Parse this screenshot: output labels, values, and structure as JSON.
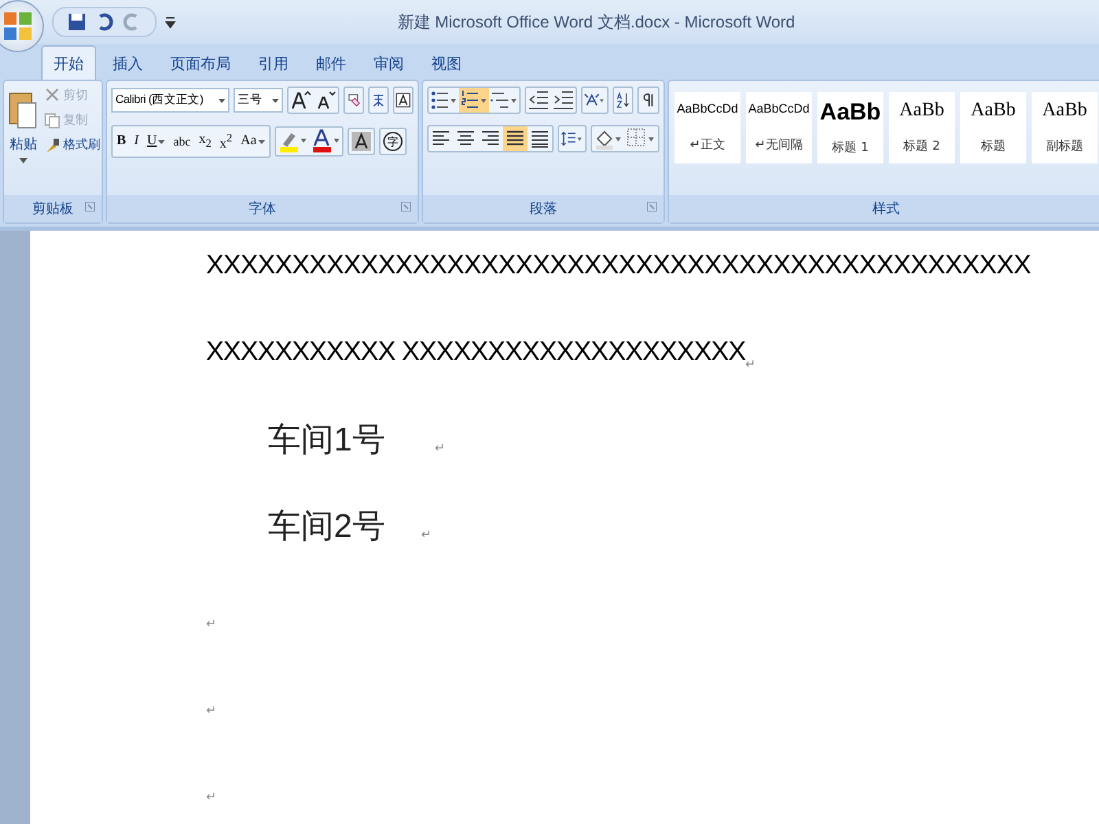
{
  "window": {
    "title": "新建 Microsoft Office Word 文档.docx - Microsoft Word"
  },
  "tabs": [
    {
      "label": "开始",
      "selected": true
    },
    {
      "label": "插入",
      "selected": false
    },
    {
      "label": "页面布局",
      "selected": false
    },
    {
      "label": "引用",
      "selected": false
    },
    {
      "label": "邮件",
      "selected": false
    },
    {
      "label": "审阅",
      "selected": false
    },
    {
      "label": "视图",
      "selected": false
    }
  ],
  "clipboard": {
    "label": "剪贴板",
    "paste": "粘贴",
    "items": [
      {
        "kind": "cut",
        "label": "剪切",
        "disabled": true
      },
      {
        "kind": "copy",
        "label": "复制",
        "disabled": true
      },
      {
        "kind": "painter",
        "label": "格式刷",
        "disabled": false
      }
    ]
  },
  "font": {
    "label": "字体",
    "font_name": "Calibri (西文正文)",
    "font_size": "三号",
    "format_buttons": [
      {
        "kind": "bold",
        "label": "B",
        "dropdown": false
      },
      {
        "kind": "italic",
        "label": "I",
        "dropdown": false
      },
      {
        "kind": "underline",
        "label": "U",
        "dropdown": true
      },
      {
        "kind": "strike",
        "label": "abc",
        "dropdown": false
      },
      {
        "kind": "plain",
        "label": "x$_{2}$",
        "dropdown": false
      },
      {
        "kind": "plain",
        "label": "x$^{2}$",
        "dropdown": false
      },
      {
        "kind": "plain",
        "label": "Aa",
        "dropdown": true
      }
    ],
    "enclosed_char": "字"
  },
  "paragraph": {
    "label": "段落",
    "lists": [
      {
        "kind": "bullets",
        "selected": false
      },
      {
        "kind": "numbering",
        "selected": true
      },
      {
        "kind": "multilevel",
        "selected": false
      }
    ],
    "alignment": [
      {
        "kind": "left",
        "selected": false
      },
      {
        "kind": "center",
        "selected": false
      },
      {
        "kind": "right",
        "selected": false
      },
      {
        "kind": "justify",
        "selected": true
      },
      {
        "kind": "distributed",
        "selected": false
      }
    ]
  },
  "styles": {
    "label": "样式",
    "items": [
      {
        "kind": "small",
        "preview": "AaBbCcDd",
        "name": "正文",
        "mark": "↵"
      },
      {
        "kind": "small",
        "preview": "AaBbCcDd",
        "name": "无间隔",
        "mark": "↵"
      },
      {
        "kind": "heading1",
        "preview": "AaBb",
        "name": "标题 1"
      },
      {
        "kind": "heading",
        "preview": "AaBb",
        "name": "标题 2"
      },
      {
        "kind": "heading",
        "preview": "AaBb",
        "name": "标题"
      },
      {
        "kind": "heading",
        "preview": "AaBb",
        "name": "副标题"
      }
    ]
  },
  "document": {
    "paragraphs": [
      {
        "kind": "body",
        "lines": [
          "XXXXXXXXXXXXXXXXXXXXXXXXXXXXXXXXXXXXXXXXXXXXXXXX",
          "XXXXXXXXXXX XXXXXXXXXXXXXXXXXXXX"
        ],
        "mark": "↵"
      },
      {
        "kind": "indented",
        "lines": [
          "车间1号"
        ],
        "mark": "↵"
      },
      {
        "kind": "indented",
        "lines": [
          "车间2号"
        ],
        "mark": "↵"
      },
      {
        "kind": "empty",
        "mark": "↵"
      },
      {
        "kind": "empty",
        "mark": "↵"
      },
      {
        "kind": "empty",
        "mark": "↵"
      }
    ]
  }
}
